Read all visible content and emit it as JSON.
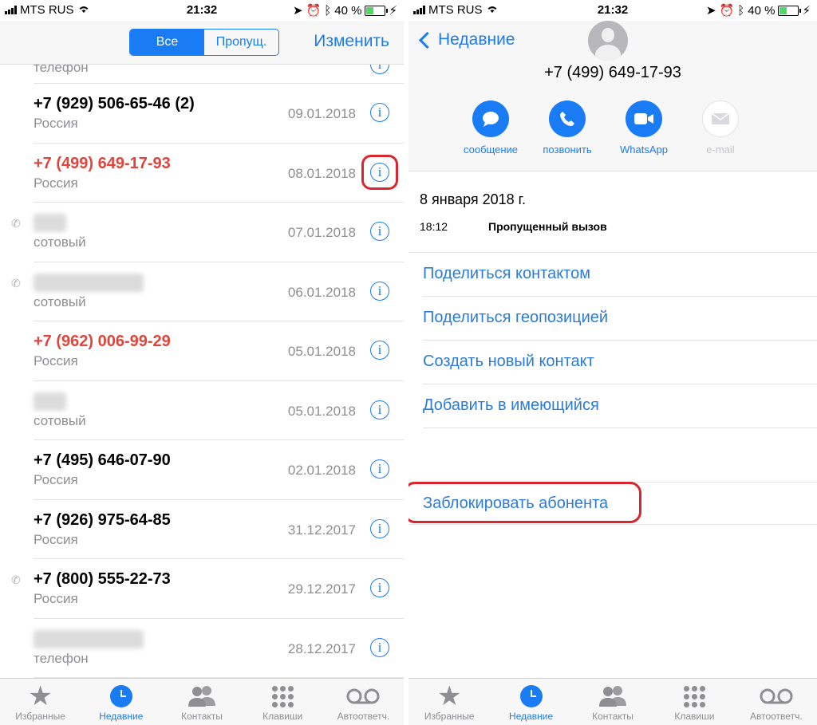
{
  "status": {
    "carrier": "MTS RUS",
    "time": "21:32",
    "battery": "40 %",
    "battery_level": 0.4
  },
  "left": {
    "segment": {
      "all": "Все",
      "missed": "Пропущ."
    },
    "edit": "Изменить",
    "calls": [
      {
        "name": "",
        "sub": "телефон",
        "date": "",
        "missed": false,
        "blurred": false,
        "partial": true
      },
      {
        "name": "+7 (929) 506-65-46 (2)",
        "sub": "Россия",
        "date": "09.01.2018",
        "missed": false,
        "blurred": false
      },
      {
        "name": "+7 (499) 649-17-93",
        "sub": "Россия",
        "date": "08.01.2018",
        "missed": true,
        "blurred": false,
        "highlight": true
      },
      {
        "name": "Имя",
        "sub": "сотовый",
        "date": "07.01.2018",
        "missed": false,
        "blurred": true,
        "outgoing": true
      },
      {
        "name": "Имя Фамилия",
        "sub": "сотовый",
        "date": "06.01.2018",
        "missed": false,
        "blurred": true,
        "outgoing": true
      },
      {
        "name": "+7 (962) 006-99-29",
        "sub": "Россия",
        "date": "05.01.2018",
        "missed": true,
        "blurred": false
      },
      {
        "name": "Имя",
        "sub": "сотовый",
        "date": "05.01.2018",
        "missed": false,
        "blurred": true
      },
      {
        "name": "+7 (495) 646-07-90",
        "sub": "Россия",
        "date": "02.01.2018",
        "missed": false,
        "blurred": false
      },
      {
        "name": "+7 (926) 975-64-85",
        "sub": "Россия",
        "date": "31.12.2017",
        "missed": false,
        "blurred": false
      },
      {
        "name": "+7 (800) 555-22-73",
        "sub": "Россия",
        "date": "29.12.2017",
        "missed": false,
        "blurred": false,
        "outgoing": true
      },
      {
        "name": "Имя Фамилия",
        "sub": "телефон",
        "date": "28.12.2017",
        "missed": false,
        "blurred": true
      }
    ]
  },
  "tabs": [
    {
      "label": "Избранные",
      "icon": "star-icon"
    },
    {
      "label": "Недавние",
      "icon": "clock-icon",
      "active": true
    },
    {
      "label": "Контакты",
      "icon": "contacts-icon"
    },
    {
      "label": "Клавиши",
      "icon": "keypad-icon"
    },
    {
      "label": "Автоответч.",
      "icon": "voicemail-icon"
    }
  ],
  "right": {
    "back": "Недавние",
    "number": "+7 (499) 649-17-93",
    "actions": [
      {
        "label": "сообщение",
        "icon": "message-icon"
      },
      {
        "label": "позвонить",
        "icon": "phone-icon"
      },
      {
        "label": "WhatsApp",
        "icon": "video-icon"
      },
      {
        "label": "e-mail",
        "icon": "mail-icon",
        "disabled": true
      }
    ],
    "call_date": "8 января 2018 г.",
    "call_time": "18:12",
    "call_type": "Пропущенный вызов",
    "menu": [
      "Поделиться контактом",
      "Поделиться геопозицией",
      "Создать новый контакт",
      "Добавить в имеющийся"
    ],
    "block": "Заблокировать абонента"
  },
  "colors": {
    "accent": "#1a7cf5",
    "missed": "#e0443a",
    "highlight": "#d9252f"
  }
}
